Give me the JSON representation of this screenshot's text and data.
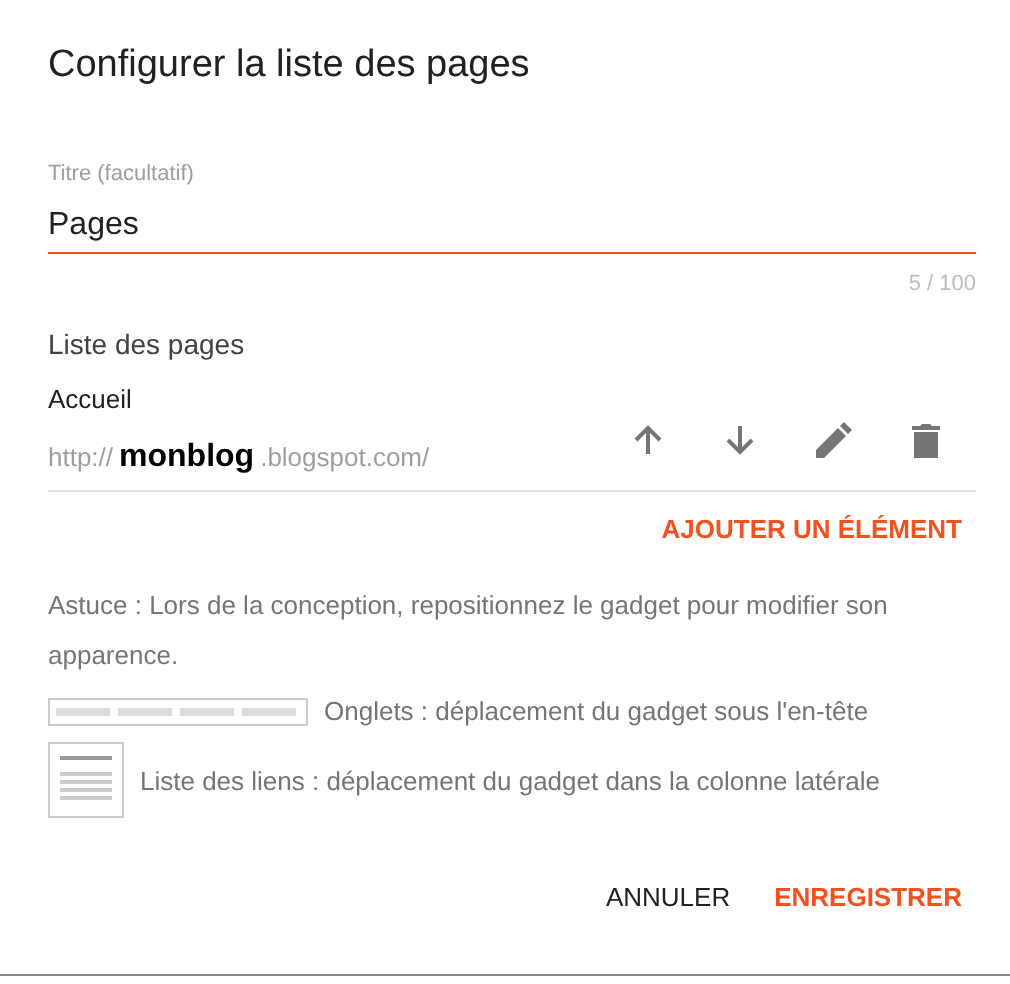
{
  "dialog": {
    "title": "Configurer la liste des pages"
  },
  "title_field": {
    "label": "Titre (facultatif)",
    "value": "Pages",
    "counter": "5 / 100"
  },
  "pages_list": {
    "label": "Liste des pages",
    "items": [
      {
        "name": "Accueil",
        "url_prefix": "http://",
        "overlay": "monblog",
        "url_suffix": ".blogspot.com/"
      }
    ],
    "add_button": "AJOUTER UN ÉLÉMENT"
  },
  "tip": "Astuce : Lors de la conception, repositionnez le gadget pour modifier son apparence.",
  "layouts": [
    {
      "kind": "tabs",
      "text": "Onglets : déplacement du gadget sous l'en-tête"
    },
    {
      "kind": "links",
      "text": "Liste des liens : déplacement du gadget dans la colonne latérale"
    }
  ],
  "buttons": [
    {
      "kind": "plain",
      "label": "ANNULER"
    },
    {
      "kind": "primary",
      "label": "ENREGISTRER"
    }
  ]
}
